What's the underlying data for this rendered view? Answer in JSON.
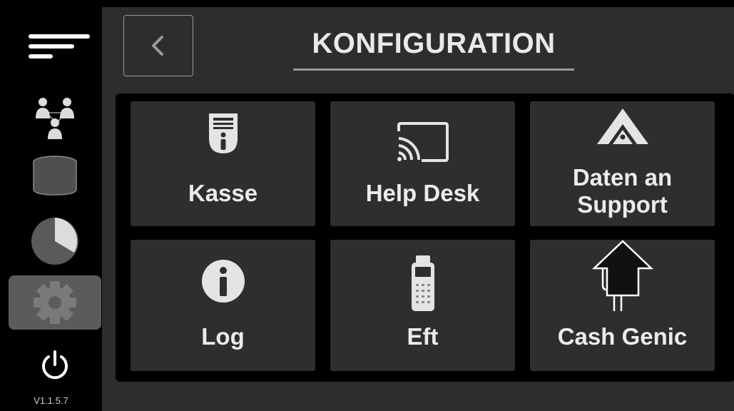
{
  "header": {
    "title": "KONFIGURATION"
  },
  "sidebar": {
    "items": [
      {
        "name": "menu-icon"
      },
      {
        "name": "users-icon"
      },
      {
        "name": "database-icon"
      },
      {
        "name": "pie-chart-icon"
      },
      {
        "name": "gear-icon",
        "active": true
      },
      {
        "name": "power-icon"
      }
    ],
    "version": "V1.1.5.7"
  },
  "tiles": [
    {
      "label": "Kasse",
      "icon": "register-info-icon"
    },
    {
      "label": "Help Desk",
      "icon": "cast-icon"
    },
    {
      "label_line1": "Daten an",
      "label_line2": "Support",
      "icon": "support-logo-icon"
    },
    {
      "label": "Log",
      "icon": "info-icon"
    },
    {
      "label": "Eft",
      "icon": "card-terminal-icon"
    },
    {
      "label": "Cash Genic",
      "icon": "cash-machine-icon"
    }
  ],
  "colors": {
    "background": "#000000",
    "panel": "#2d2d2d",
    "tile": "#2e2e2e",
    "active_sidebar": "#5b5b5b",
    "text": "#ececec",
    "border": "#9a9a9a"
  }
}
